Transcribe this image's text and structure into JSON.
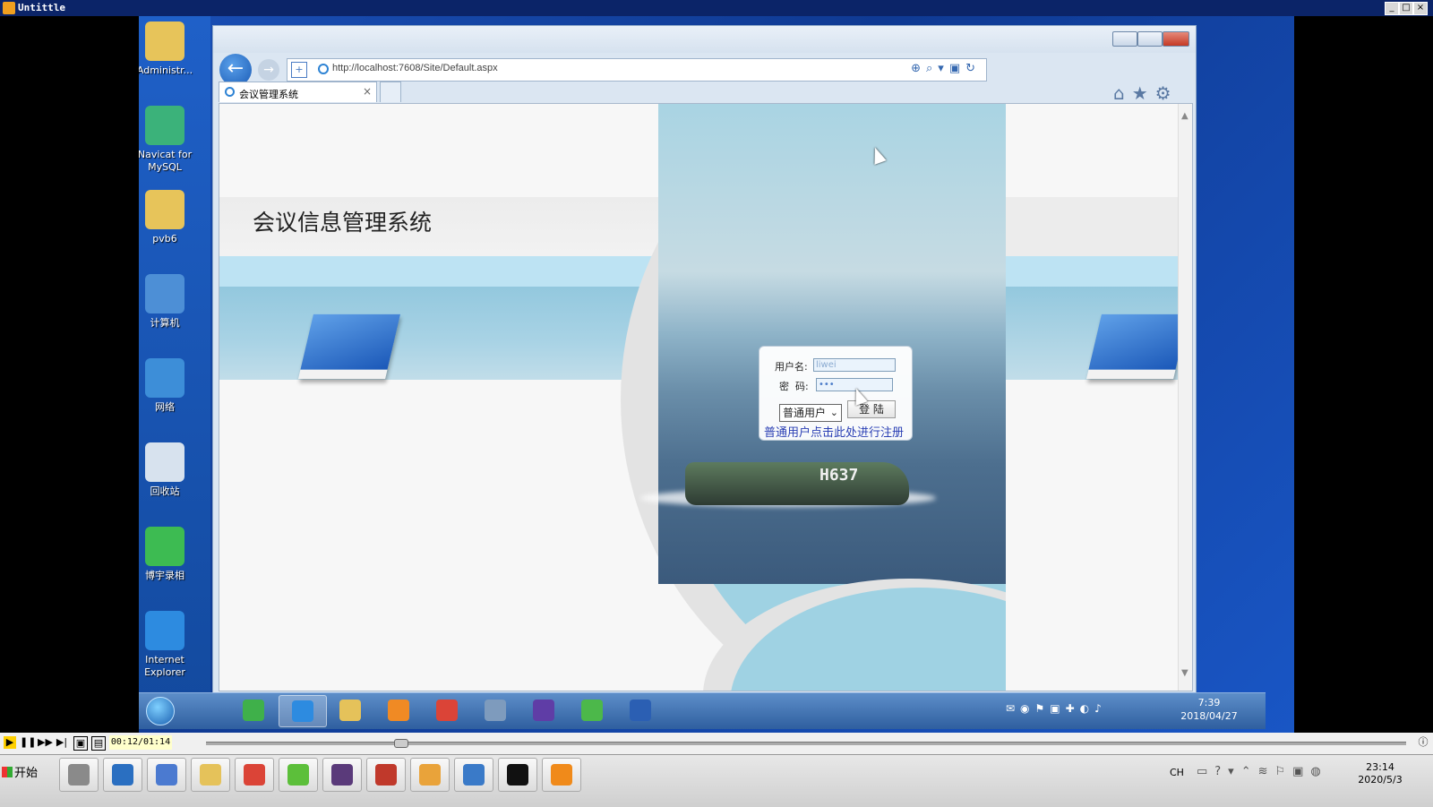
{
  "player": {
    "title": "Untittle",
    "time": "00:12/01:14",
    "progress_fraction": 0.162
  },
  "desktop_icons": [
    {
      "label": "Administr...",
      "icon": "user-folder-icon",
      "color": "#e7c45a"
    },
    {
      "label": "Navicat for MySQL",
      "icon": "navicat-icon",
      "color": "#3bb27a"
    },
    {
      "label": "pvb6",
      "icon": "folder-icon",
      "color": "#e7c45a"
    },
    {
      "label": "计算机",
      "icon": "computer-icon",
      "color": "#4d8fd6"
    },
    {
      "label": "网络",
      "icon": "network-icon",
      "color": "#3d8ed8"
    },
    {
      "label": "回收站",
      "icon": "recycle-bin-icon",
      "color": "#d7e2ee"
    },
    {
      "label": "博宇录相",
      "icon": "recorder-icon",
      "color": "#3dbb52"
    },
    {
      "label": "Internet Explorer",
      "icon": "ie-icon",
      "color": "#2d8be0"
    }
  ],
  "browser": {
    "url": "http://localhost:7608/Site/Default.aspx",
    "tab_title": "会议管理系统",
    "tab_close": "×"
  },
  "page": {
    "site_title": "会议信息管理系统",
    "tank_marking": "H637",
    "login": {
      "username_label": "用户名:",
      "username_value": "liwei",
      "password_label": "密  码:",
      "password_value": "•••",
      "role_value": "普通用户",
      "login_button": "登 陆",
      "register_link": "普通用户点击此处进行注册"
    }
  },
  "inner_taskbar": {
    "time": "7:39",
    "date": "2018/04/27",
    "apps": [
      {
        "icon": "refresh-app-icon",
        "color": "#3fb04a"
      },
      {
        "icon": "ie-icon",
        "color": "#2d8be0",
        "active": true
      },
      {
        "icon": "explorer-folder-icon",
        "color": "#e5c25a"
      },
      {
        "icon": "media-player-icon",
        "color": "#f08a24"
      },
      {
        "icon": "chrome-icon",
        "color": "#db4437"
      },
      {
        "icon": "tools-icon",
        "color": "#7e9bbd"
      },
      {
        "icon": "visual-studio-icon",
        "color": "#5f3da6"
      },
      {
        "icon": "clover-icon",
        "color": "#4cb84a"
      },
      {
        "icon": "word-icon",
        "color": "#2b5fb3"
      }
    ]
  },
  "host_taskbar": {
    "start_label": "开始",
    "lang": "CH",
    "time": "23:14",
    "date": "2020/5/3",
    "apps": [
      {
        "icon": "server-manager-icon",
        "color": "#8a8a8a"
      },
      {
        "icon": "powershell-icon",
        "color": "#2a6fc1"
      },
      {
        "icon": "bird-app-icon",
        "color": "#4b7ad0"
      },
      {
        "icon": "explorer-folder-icon",
        "color": "#e5c25a"
      },
      {
        "icon": "chrome-icon",
        "color": "#db4437"
      },
      {
        "icon": "clover-icon",
        "color": "#5cbf3a"
      },
      {
        "icon": "java-ee-ide-icon",
        "color": "#5a3a7a"
      },
      {
        "icon": "recorder-icon",
        "color": "#c0392b"
      },
      {
        "icon": "photo-app-icon",
        "color": "#e9a33a"
      },
      {
        "icon": "remote-desktop-icon",
        "color": "#3a7ac8"
      },
      {
        "icon": "cmd-icon",
        "color": "#111111"
      },
      {
        "icon": "player-app-icon",
        "color": "#f08a1a"
      }
    ]
  },
  "colors": {
    "link": "#2a3fb4",
    "band_light": "#bde3f3",
    "player_titlebar": "#0b2468"
  }
}
